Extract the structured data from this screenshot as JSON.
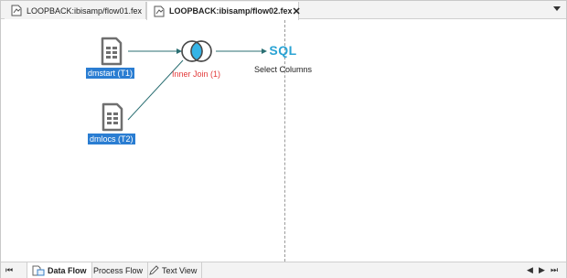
{
  "tabs": [
    {
      "label": "LOOPBACK:ibisamp/flow01.fex",
      "active": false
    },
    {
      "label": "LOOPBACK:ibisamp/flow02.fex",
      "active": true,
      "close": "✕"
    }
  ],
  "flow": {
    "source1": {
      "label": "dmstart (T1)"
    },
    "source2": {
      "label": "dmlocs (T2)"
    },
    "join": {
      "label": "Inner Join (1)"
    },
    "target": {
      "icon_text": "SQL",
      "label": "Select Columns"
    }
  },
  "bottom_tabs": [
    {
      "label": "Data Flow",
      "active": true,
      "icon": "data-flow-icon"
    },
    {
      "label": "Process Flow",
      "active": false
    },
    {
      "label": "Text View",
      "active": false,
      "icon": "pencil-icon"
    }
  ],
  "nav": {
    "first": "⏮",
    "prev": "◀",
    "next": "▶",
    "last": "⏭"
  },
  "colors": {
    "accent": "#2a7dd2",
    "join_label": "#e23b3b",
    "sql": "#2aa3d4",
    "connector": "#2b6f73"
  }
}
